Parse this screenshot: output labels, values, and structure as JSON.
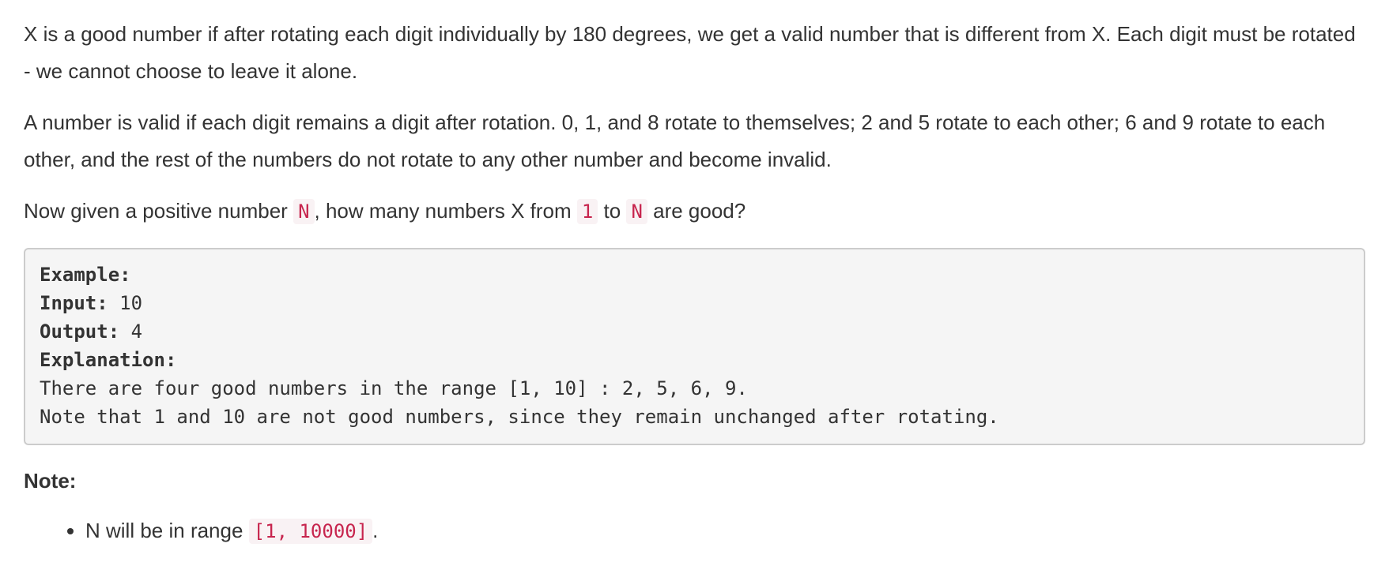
{
  "paragraph1": {
    "text": "X is a good number if after rotating each digit individually by 180 degrees, we get a valid number that is different from X.  Each digit must be rotated - we cannot choose to leave it alone."
  },
  "paragraph2": {
    "text": "A number is valid if each digit remains a digit after rotation. 0, 1, and 8 rotate to themselves; 2 and 5 rotate to each other; 6 and 9 rotate to each other, and the rest of the numbers do not rotate to any other number and become invalid."
  },
  "paragraph3": {
    "prefix": "Now given a positive number ",
    "code_n": "N",
    "middle": ", how many numbers X from ",
    "code_1": "1",
    "to": " to ",
    "code_n2": "N",
    "suffix": " are good?"
  },
  "example": {
    "heading": "Example:",
    "input_label": "Input:",
    "input_value": " 10",
    "output_label": "Output:",
    "output_value": " 4",
    "explanation_label": "Explanation:",
    "line1": "There are four good numbers in the range [1, 10] : 2, 5, 6, 9.",
    "line2": "Note that 1 and 10 are not good numbers, since they remain unchanged after rotating."
  },
  "note": {
    "heading": "Note:",
    "item_prefix": "N",
    "item_middle": " will be in range ",
    "item_code": "[1, 10000]",
    "item_suffix": "."
  }
}
